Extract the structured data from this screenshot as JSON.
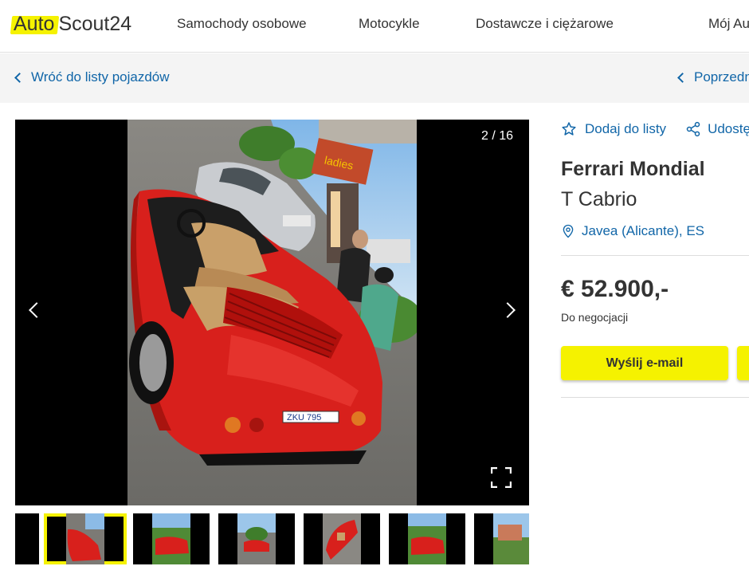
{
  "header": {
    "logo_auto": "Auto",
    "logo_scout": "Scout24",
    "nav": [
      "Samochody osobowe",
      "Motocykle",
      "Dostawcze i ciężarowe",
      "Mój Au"
    ]
  },
  "subbar": {
    "back_label": "Wróć do listy pojazdów",
    "prev_label": "Poprzedn"
  },
  "gallery": {
    "counter": "2 / 16",
    "license_plate": "ZKU 795",
    "shop_sign": "ladies",
    "thumbnail_count": 7,
    "active_thumbnail": 2
  },
  "listing": {
    "add_to_list": "Dodaj do listy",
    "share": "Udostę",
    "title": "Ferrari Mondial",
    "subtitle": "T Cabrio",
    "location": "Javea (Alicante), ES",
    "price": "€ 52.900,-",
    "negotiation": "Do negocjacji",
    "email_button": "Wyślij e-mail"
  },
  "colors": {
    "brand_yellow": "#f5f200",
    "link_blue": "#1166a8",
    "text_dark": "#333333",
    "car_red": "#d8201c"
  }
}
